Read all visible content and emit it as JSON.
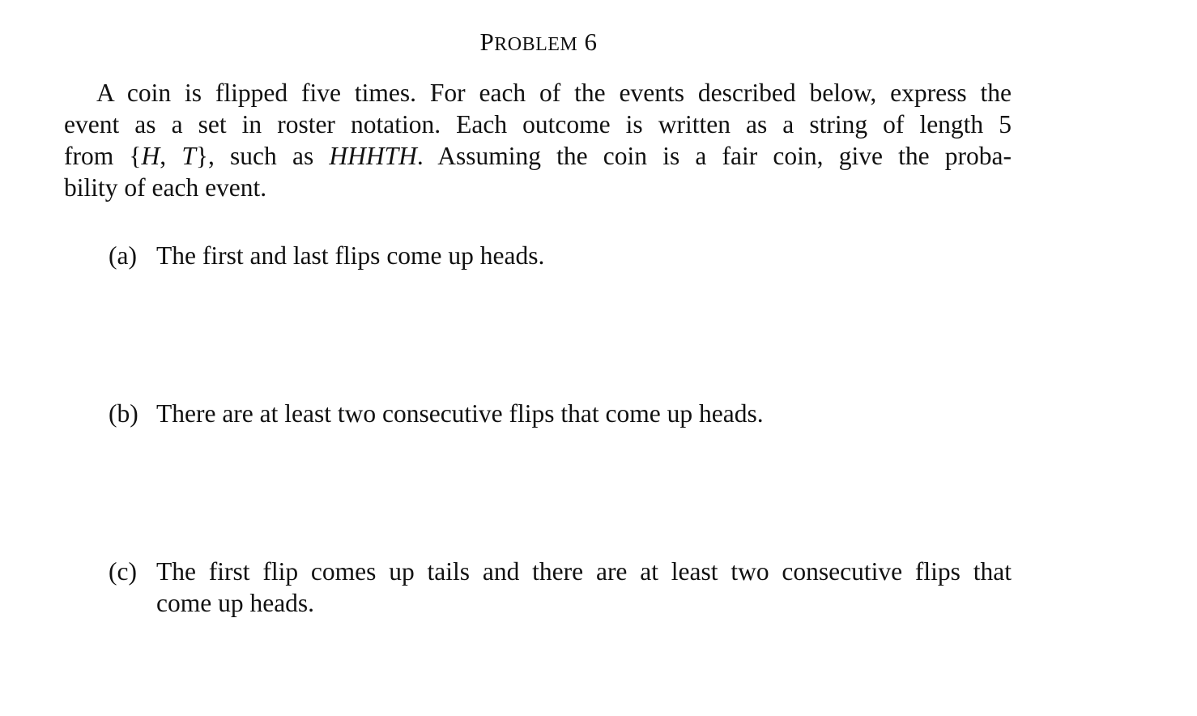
{
  "problem": {
    "title_first": "P",
    "title_rest": "ROBLEM",
    "title_number": "6",
    "intro_lines": [
      "A coin is flipped five times. For each of the events described below, express the",
      "event as a set in roster notation. Each outcome is written as a string of length 5",
      "bility of each event."
    ],
    "intro_line3_a": "from {",
    "intro_line3_H": "H",
    "intro_line3_comma": ", ",
    "intro_line3_T": "T",
    "intro_line3_b": "}, such as ",
    "intro_line3_example": "HHHTH",
    "intro_line3_c": ". Assuming the coin is a fair coin, give the proba-",
    "parts": [
      {
        "label": "(a)",
        "lines": [
          "The first and last flips come up heads."
        ]
      },
      {
        "label": "(b)",
        "lines": [
          "There are at least two consecutive flips that come up heads."
        ]
      },
      {
        "label": "(c)",
        "lines": [
          "The first flip comes up tails and there are at least two consecutive flips that",
          "come up heads."
        ]
      }
    ]
  }
}
